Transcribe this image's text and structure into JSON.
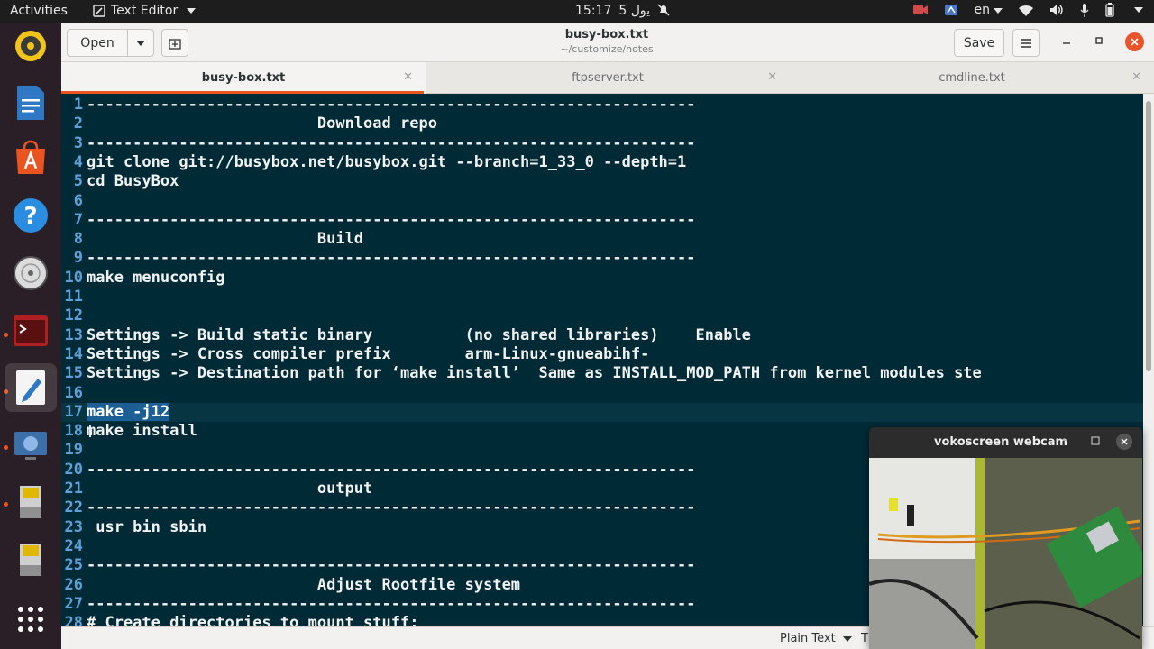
{
  "topbar": {
    "activities": "Activities",
    "app_name": "Text Editor",
    "clock_time": "15:17",
    "clock_date": "5 يول",
    "lang": "en"
  },
  "headerbar": {
    "open_label": "Open",
    "title": "busy-box.txt",
    "subtitle": "~/customize/notes",
    "save_label": "Save"
  },
  "tabs": [
    {
      "label": "busy-box.txt"
    },
    {
      "label": "ftpserver.txt"
    },
    {
      "label": "cmdline.txt"
    }
  ],
  "editor": {
    "lines": [
      {
        "n": "1",
        "text": "------------------------------------------------------------------"
      },
      {
        "n": "2",
        "text": "                         Download repo"
      },
      {
        "n": "3",
        "text": "------------------------------------------------------------------"
      },
      {
        "n": "4",
        "text": "git clone git://busybox.net/busybox.git --branch=1_33_0 --depth=1"
      },
      {
        "n": "5",
        "text": "cd BusyBox"
      },
      {
        "n": "6",
        "text": ""
      },
      {
        "n": "7",
        "text": "------------------------------------------------------------------"
      },
      {
        "n": "8",
        "text": "                         Build"
      },
      {
        "n": "9",
        "text": "------------------------------------------------------------------"
      },
      {
        "n": "10",
        "text": "make menuconfig"
      },
      {
        "n": "11",
        "text": ""
      },
      {
        "n": "12",
        "text": ""
      },
      {
        "n": "13",
        "text": "Settings -> Build static binary          (no shared libraries)    Enable"
      },
      {
        "n": "14",
        "text": "Settings -> Cross compiler prefix        arm-Linux-gnueabihf-"
      },
      {
        "n": "15",
        "text": "Settings -> Destination path for ‘make install’  Same as INSTALL_MOD_PATH from kernel modules ste"
      },
      {
        "n": "16",
        "text": ""
      },
      {
        "n": "17",
        "text": "make -j12"
      },
      {
        "n": "18",
        "text": "make install"
      },
      {
        "n": "19",
        "text": ""
      },
      {
        "n": "20",
        "text": "------------------------------------------------------------------"
      },
      {
        "n": "21",
        "text": "                         output"
      },
      {
        "n": "22",
        "text": "------------------------------------------------------------------"
      },
      {
        "n": "23",
        "text": " usr bin sbin"
      },
      {
        "n": "24",
        "text": ""
      },
      {
        "n": "25",
        "text": "------------------------------------------------------------------"
      },
      {
        "n": "26",
        "text": "                         Adjust Rootfile system"
      },
      {
        "n": "27",
        "text": "------------------------------------------------------------------"
      },
      {
        "n": "28",
        "text": "# Create directories to mount stuff:"
      }
    ],
    "highlighted_line": "17"
  },
  "statusbar": {
    "language": "Plain Text",
    "tab_width_partial": "T"
  },
  "webcam": {
    "title": "vokoscreen webcam"
  },
  "colors": {
    "editor_bg": "#002b36",
    "line_number": "#5ea0d8",
    "accent": "#e95420",
    "selection": "#1c5f94"
  }
}
